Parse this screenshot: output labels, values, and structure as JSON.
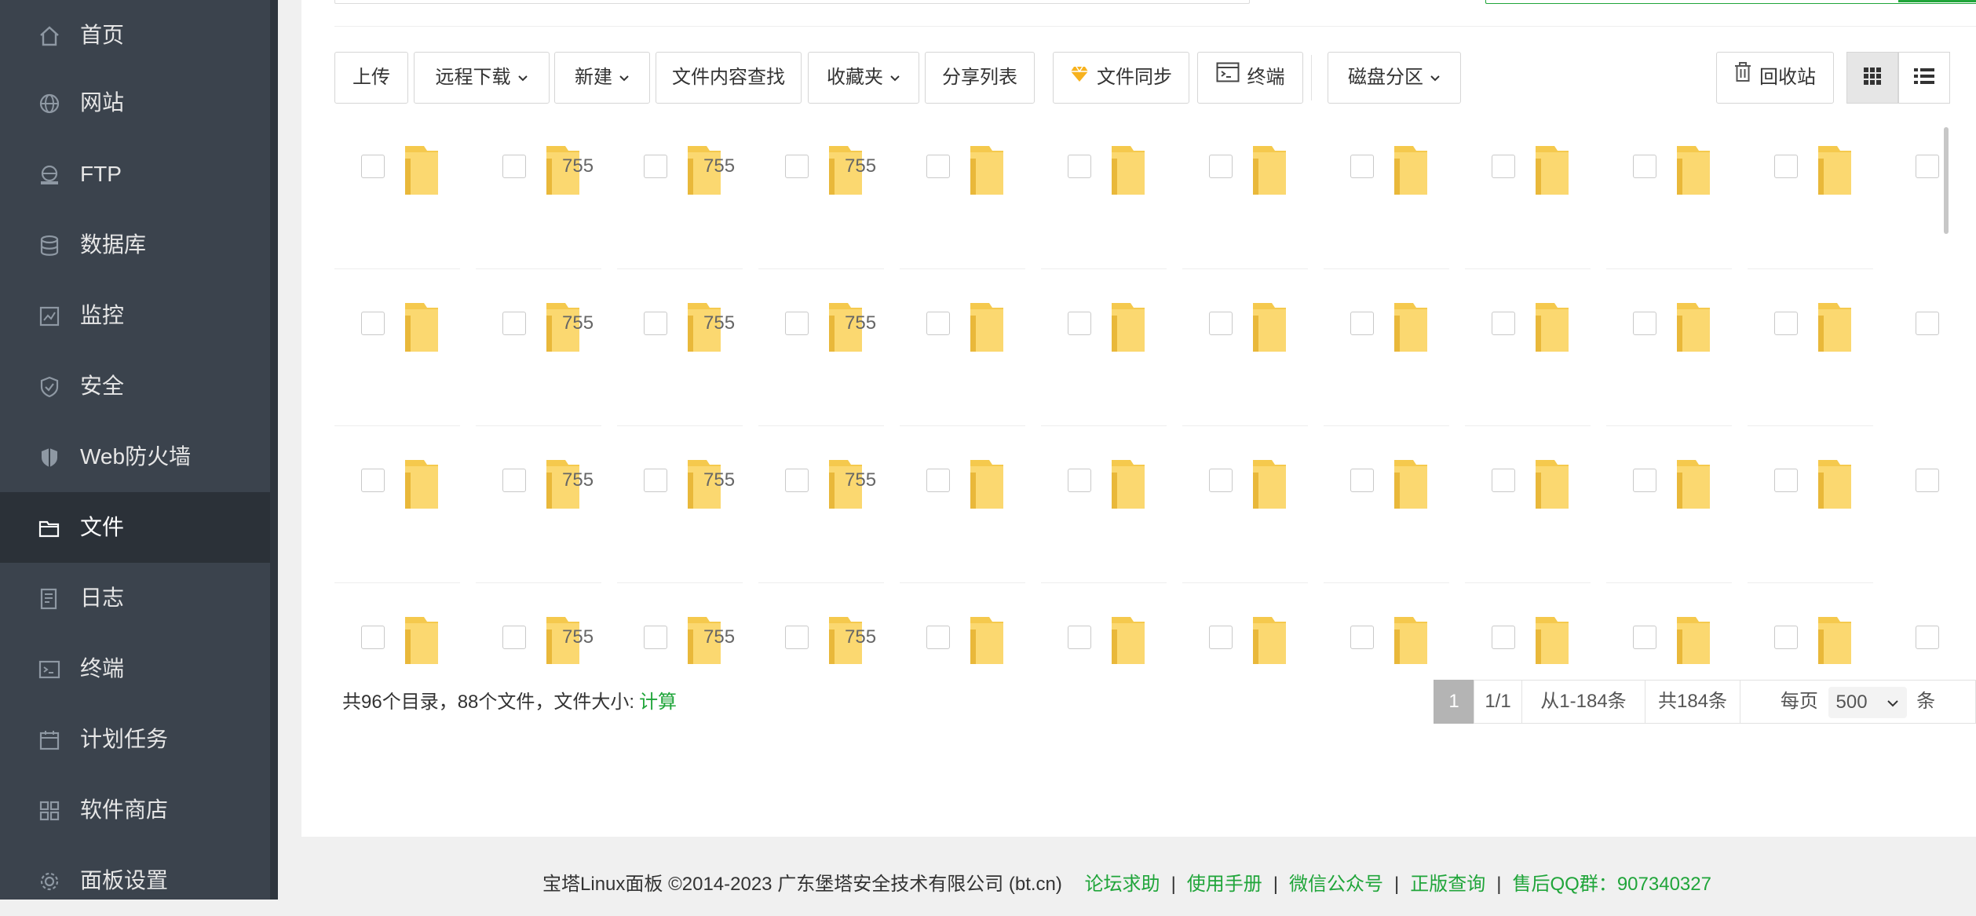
{
  "sidebar": {
    "items": [
      {
        "label": "首页",
        "icon": "home-icon",
        "active": false
      },
      {
        "label": "网站",
        "icon": "globe-icon",
        "active": false
      },
      {
        "label": "FTP",
        "icon": "ftp-icon",
        "active": false
      },
      {
        "label": "数据库",
        "icon": "database-icon",
        "active": false
      },
      {
        "label": "监控",
        "icon": "monitor-icon",
        "active": false
      },
      {
        "label": "安全",
        "icon": "shield-icon",
        "active": false
      },
      {
        "label": "Web防火墙",
        "icon": "firewall-icon",
        "active": false
      },
      {
        "label": "文件",
        "icon": "folder-icon",
        "active": true
      },
      {
        "label": "日志",
        "icon": "log-icon",
        "active": false
      },
      {
        "label": "终端",
        "icon": "terminal-icon",
        "active": false
      },
      {
        "label": "计划任务",
        "icon": "calendar-icon",
        "active": false
      },
      {
        "label": "软件商店",
        "icon": "apps-icon",
        "active": false
      },
      {
        "label": "面板设置",
        "icon": "gear-icon",
        "active": false
      }
    ]
  },
  "toolbar": {
    "upload": "上传",
    "remote_download": "远程下载",
    "new": "新建",
    "content_search": "文件内容查找",
    "favorites": "收藏夹",
    "share_list": "分享列表",
    "file_sync": "文件同步",
    "terminal": "终端",
    "disk_partition": "磁盘分区",
    "recycle_bin": "回收站",
    "view_mode": "grid"
  },
  "files": {
    "perm_value": "755",
    "rows": 4
  },
  "summary": {
    "text": "共96个目录，88个文件，文件大小:",
    "calc_link": "计算"
  },
  "pagination": {
    "current_page": "1",
    "page_of": "1/1",
    "range": "从1-184条",
    "total": "共184条",
    "per_page_label": "每页",
    "per_page_value": "500",
    "per_page_unit": "条"
  },
  "footer": {
    "copyright": "宝塔Linux面板 ©2014-2023 广东堡塔安全技术有限公司 (bt.cn)",
    "links": [
      "论坛求助",
      "使用手册",
      "微信公众号",
      "正版查询",
      "售后QQ群：907340327"
    ]
  },
  "colors": {
    "sidebar_bg": "#3b434d",
    "sidebar_active": "#2b3138",
    "accent_green": "#20a53a",
    "folder_yellow": "#f5c94d"
  }
}
